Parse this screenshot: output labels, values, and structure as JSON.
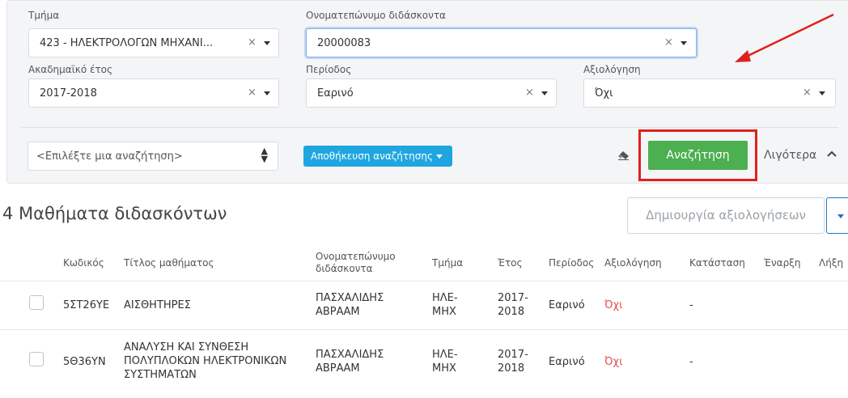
{
  "filters": {
    "department": {
      "label": "Τμήμα",
      "value": "423 - ΗΛΕΚΤΡΟΛΟΓΩΝ ΜΗΧΑΝΙ..."
    },
    "instructor": {
      "label": "Ονοματεπώνυμο διδάσκοντα",
      "value": "20000083"
    },
    "year": {
      "label": "Ακαδημαϊκό έτος",
      "value": "2017-2018"
    },
    "period": {
      "label": "Περίοδος",
      "value": "Εαρινό"
    },
    "evaluation": {
      "label": "Αξιολόγηση",
      "value": "Όχι"
    },
    "clear_symbol": "×"
  },
  "saved_search": {
    "placeholder": "<Επιλέξτε μια αναζήτηση>"
  },
  "save_search_label": "Αποθήκευση αναζήτησης",
  "search_button_label": "Αναζήτηση",
  "more_label": "Λιγότερα",
  "page_title": "4 Μαθήματα διδασκόντων",
  "create_button_label": "Δημιουργία αξιολογήσεων",
  "table": {
    "headers": {
      "code": "Κωδικός",
      "title": "Τίτλος μαθήματος",
      "instructor": "Ονοματεπώνυμο διδάσκοντα",
      "department": "Τμήμα",
      "year": "Έτος",
      "period": "Περίοδος",
      "evaluation": "Αξιολόγηση",
      "status": "Κατάσταση",
      "start": "Έναρξη",
      "end": "Λήξη"
    },
    "rows": [
      {
        "code": "5ΣΤ26ΥΕ",
        "title": "ΑΙΣΘΗΤΗΡΕΣ",
        "instructor": "ΠΑΣΧΑΛΙΔΗΣ ΑΒΡΑΑΜ",
        "department": "ΗΛΕ-ΜΗΧ",
        "year": "2017-2018",
        "period": "Εαρινό",
        "evaluation": "Όχι",
        "status": "-"
      },
      {
        "code": "5Θ36ΥΝ",
        "title": "ΑΝΑΛΥΣΗ ΚΑΙ ΣΥΝΘΕΣΗ ΠΟΛΥΠΛΟΚΩΝ ΗΛΕΚΤΡΟΝΙΚΩΝ ΣΥΣΤΗΜΑΤΩΝ",
        "instructor": "ΠΑΣΧΑΛΙΔΗΣ ΑΒΡΑΑΜ",
        "department": "ΗΛΕ-ΜΗΧ",
        "year": "2017-2018",
        "period": "Εαρινό",
        "evaluation": "Όχι",
        "status": "-"
      }
    ]
  },
  "colors": {
    "accent_blue": "#1fa6e0",
    "search_green": "#4caf50",
    "highlight_red": "#e0201c",
    "no_red": "#e04c4c"
  }
}
